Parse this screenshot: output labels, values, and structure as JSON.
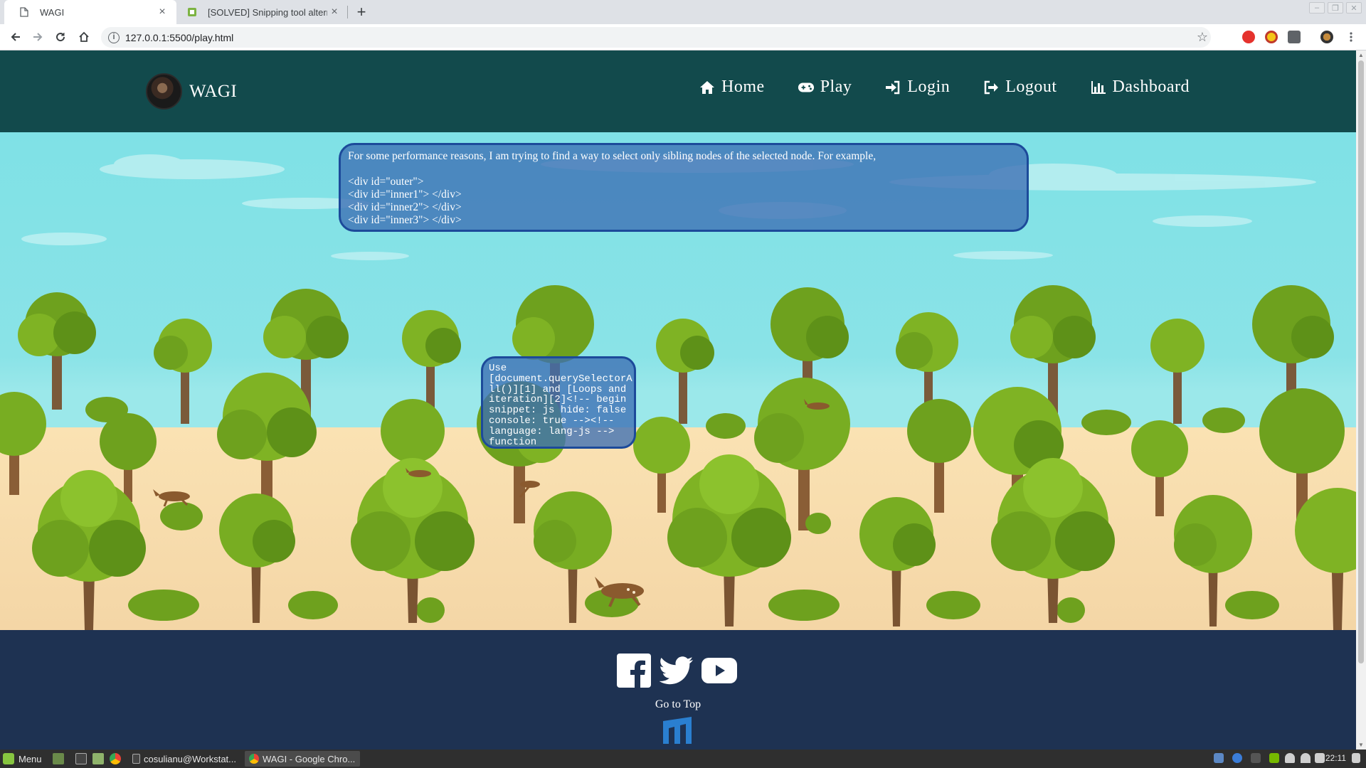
{
  "browser": {
    "tabs": [
      {
        "title": "WAGI",
        "active": true,
        "close_label": "×"
      },
      {
        "title": "[SOLVED] Snipping tool alternat",
        "active": false,
        "close_label": "×"
      }
    ],
    "new_tab_label": "+",
    "address_bar": {
      "url": "127.0.0.1:5500/play.html"
    },
    "nav_buttons": [
      "back",
      "forward",
      "reload",
      "home"
    ],
    "window_controls": [
      "minimize",
      "restore",
      "close"
    ]
  },
  "page": {
    "brand": {
      "name": "WAGI"
    },
    "nav": [
      {
        "label": "Home",
        "icon": "home-icon"
      },
      {
        "label": "Play",
        "icon": "gamepad-icon"
      },
      {
        "label": "Login",
        "icon": "sign-in-icon"
      },
      {
        "label": "Logout",
        "icon": "sign-out-icon"
      },
      {
        "label": "Dashboard",
        "icon": "bar-chart-icon"
      }
    ],
    "question_bubble": {
      "lines": [
        "For some performance reasons, I am trying to find a way to select only sibling nodes of the selected node. For example,",
        "",
        "<div id=\"outer\">",
        "<div id=\"inner1\"> </div>",
        "<div id=\"inner2\"> </div>",
        "<div id=\"inner3\"> </div>"
      ]
    },
    "answer_bubble": {
      "lines": [
        "Use",
        "[document.querySelectorA",
        "ll()][1] and [Loops and",
        "iteration][2]<!-- begin",
        "snippet: js hide: false",
        "console: true --><!--",
        "language: lang-js -->",
        "function"
      ]
    },
    "footer": {
      "social": [
        "facebook-icon",
        "twitter-icon",
        "youtube-icon"
      ],
      "goto_top": "Go to Top"
    },
    "colors": {
      "navbar": "#124a4c",
      "sky": "#7fe1e6",
      "ground": "#fae2b3",
      "footer": "#1e3252",
      "bubble": "#3c6eb4"
    }
  },
  "taskbar": {
    "menu_label": "Menu",
    "windows": [
      {
        "label": "cosulianu@Workstat...",
        "active": false
      },
      {
        "label": "WAGI - Google Chro...",
        "active": true
      }
    ],
    "clock": "22:11"
  }
}
